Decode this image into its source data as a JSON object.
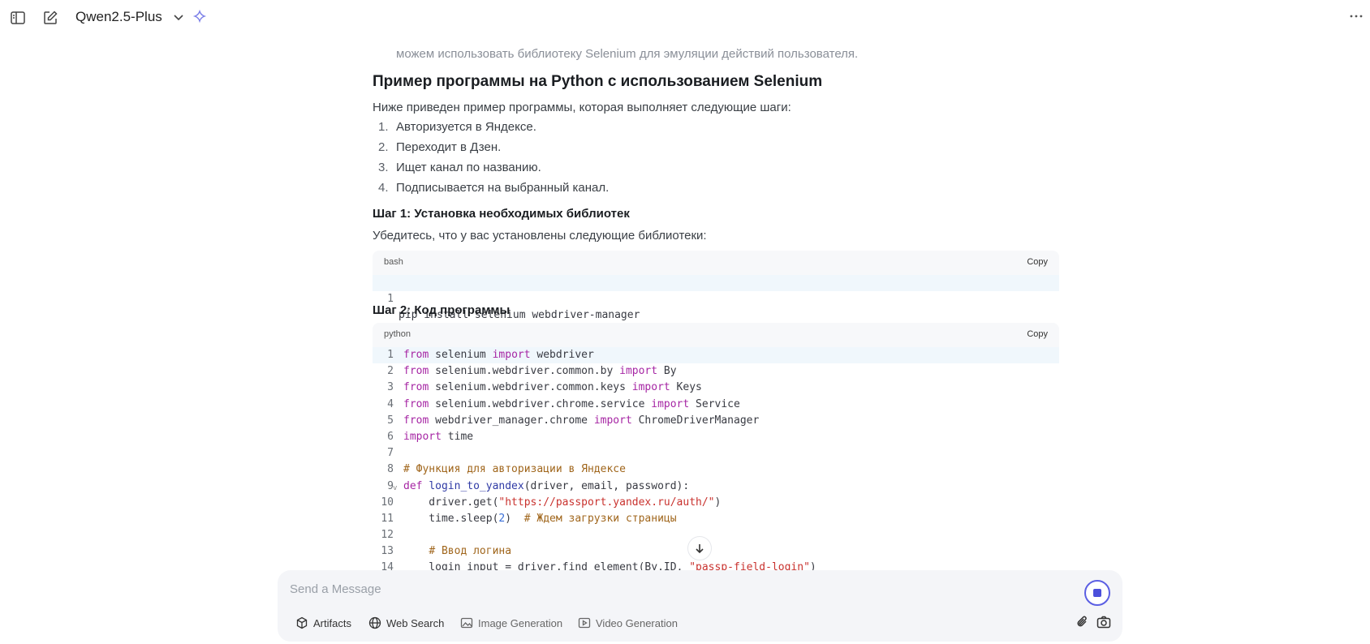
{
  "header": {
    "model_name": "Qwen2.5-Plus"
  },
  "content": {
    "faded_line": "можем использовать библиотеку Selenium для эмуляции действий пользователя.",
    "heading": "Пример программы на Python с использованием Selenium",
    "intro": "Ниже приведен пример программы, которая выполняет следующие шаги:",
    "steps": [
      {
        "num": "1.",
        "text": "Авторизуется в Яндексе."
      },
      {
        "num": "2.",
        "text": "Переходит в Дзен."
      },
      {
        "num": "3.",
        "text": "Ищет канал по названию."
      },
      {
        "num": "4.",
        "text": "Подписывается на выбранный канал."
      }
    ],
    "step1_heading": "Шаг 1: Установка необходимых библиотек",
    "step1_text": "Убедитесь, что у вас установлены следующие библиотеки:",
    "step2_heading": "Шаг 2: Код программы",
    "code1": {
      "lang": "bash",
      "copy_label": "Copy",
      "lines": [
        {
          "n": "1",
          "text": "pip install selenium webdriver-manager"
        }
      ]
    },
    "code2": {
      "lang": "python",
      "copy_label": "Copy",
      "lines": [
        {
          "n": "1",
          "text": "from selenium import webdriver"
        },
        {
          "n": "2",
          "text": "from selenium.webdriver.common.by import By"
        },
        {
          "n": "3",
          "text": "from selenium.webdriver.common.keys import Keys"
        },
        {
          "n": "4",
          "text": "from selenium.webdriver.chrome.service import Service"
        },
        {
          "n": "5",
          "text": "from webdriver_manager.chrome import ChromeDriverManager"
        },
        {
          "n": "6",
          "text": "import time"
        },
        {
          "n": "7",
          "text": ""
        },
        {
          "n": "8",
          "text": "# Функция для авторизации в Яндексе"
        },
        {
          "n": "9",
          "text": "def login_to_yandex(driver, email, password):"
        },
        {
          "n": "10",
          "text": "    driver.get(\"https://passport.yandex.ru/auth/\")"
        },
        {
          "n": "11",
          "text": "    time.sleep(2)  # Ждем загрузки страницы"
        },
        {
          "n": "12",
          "text": ""
        },
        {
          "n": "13",
          "text": "    # Ввод логина"
        },
        {
          "n": "14",
          "text": "    login_input = driver.find_element(By.ID, \"passp-field-login\")"
        }
      ]
    }
  },
  "composer": {
    "placeholder": "Send a Message",
    "tools": [
      {
        "label": "Artifacts",
        "icon": "cube-icon"
      },
      {
        "label": "Web Search",
        "icon": "globe-icon"
      },
      {
        "label": "Image Generation",
        "icon": "image-icon"
      },
      {
        "label": "Video Generation",
        "icon": "video-icon"
      }
    ]
  },
  "colors": {
    "accent": "#4b4fdb",
    "keyword": "#a626a4",
    "string": "#c9322e",
    "comment": "#a0661c"
  }
}
